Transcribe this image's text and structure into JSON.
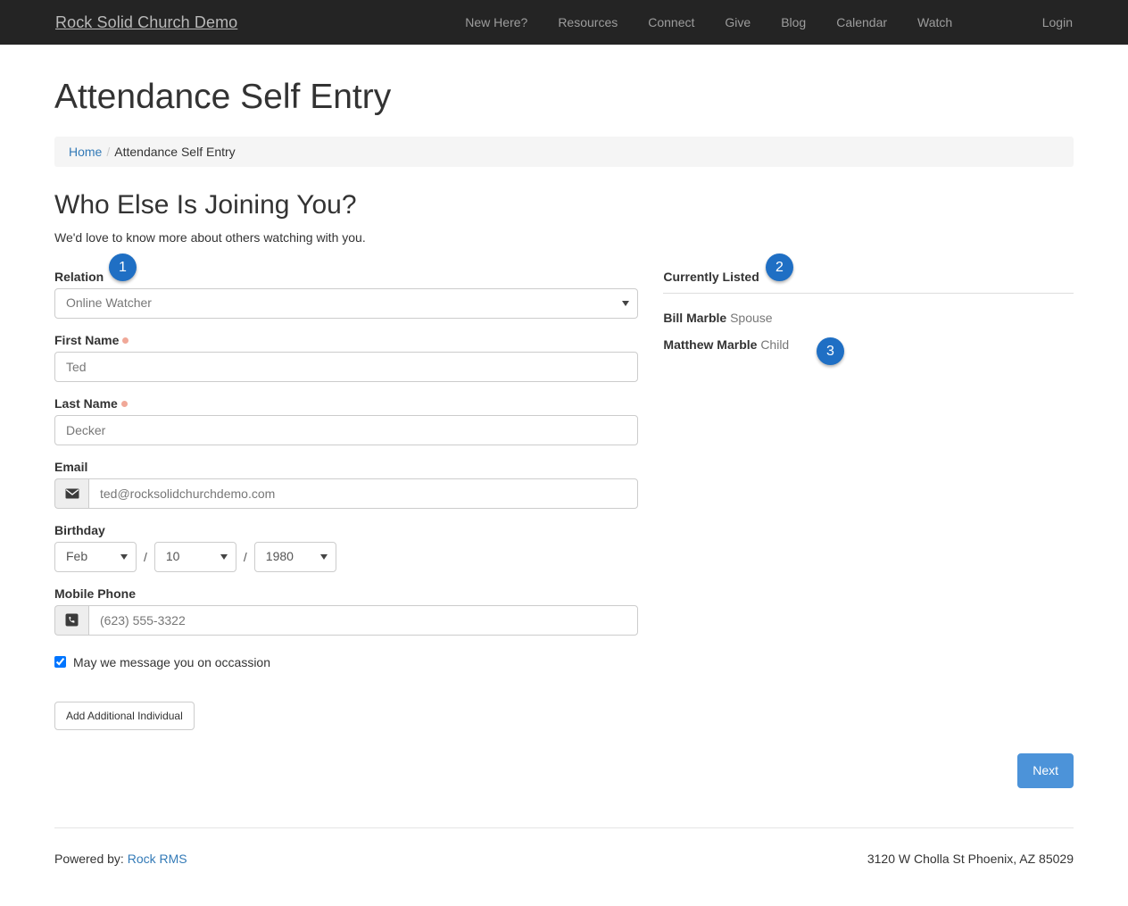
{
  "navbar": {
    "brand": "Rock Solid Church Demo",
    "links": [
      {
        "label": "New Here?"
      },
      {
        "label": "Resources"
      },
      {
        "label": "Connect"
      },
      {
        "label": "Give"
      },
      {
        "label": "Blog"
      },
      {
        "label": "Calendar"
      },
      {
        "label": "Watch"
      }
    ],
    "login_label": "Login",
    "background_color": "#242424",
    "link_color": "#9d9d9d"
  },
  "page": {
    "title": "Attendance Self Entry"
  },
  "breadcrumb": {
    "home_label": "Home",
    "separator": "/",
    "current_label": "Attendance Self Entry"
  },
  "section": {
    "heading": "Who Else Is Joining You?",
    "subtext": "We'd love to know more about others watching with you."
  },
  "form": {
    "relation": {
      "label": "Relation",
      "value": "Online Watcher",
      "options": [
        "Online Watcher"
      ]
    },
    "first_name": {
      "label": "First Name",
      "required": true,
      "placeholder": "Ted",
      "value": ""
    },
    "last_name": {
      "label": "Last Name",
      "required": true,
      "placeholder": "Decker",
      "value": ""
    },
    "email": {
      "label": "Email",
      "placeholder": "ted@rocksolidchurchdemo.com",
      "value": "",
      "icon": "envelope-icon"
    },
    "birthday": {
      "label": "Birthday",
      "separator": "/",
      "month": {
        "value": "Feb",
        "options": [
          "Feb"
        ]
      },
      "day": {
        "value": "10",
        "options": [
          "10"
        ]
      },
      "year": {
        "value": "1980",
        "options": [
          "1980"
        ]
      }
    },
    "mobile_phone": {
      "label": "Mobile Phone",
      "placeholder": "(623) 555-3322",
      "value": "",
      "icon": "phone-square-icon"
    },
    "message_consent": {
      "label": "May we message you on occassion",
      "checked": true
    },
    "add_individual_button": "Add Additional Individual",
    "next_button": "Next"
  },
  "currently_listed": {
    "heading": "Currently Listed",
    "people": [
      {
        "name": "Bill Marble",
        "relation": "Spouse"
      },
      {
        "name": "Matthew Marble",
        "relation": "Child"
      }
    ]
  },
  "footer": {
    "powered_by_label": "Powered by:",
    "powered_by_link": "Rock RMS",
    "address": "3120 W Cholla St Phoenix, AZ 85029"
  },
  "annotations": [
    {
      "number": "1"
    },
    {
      "number": "2"
    },
    {
      "number": "3"
    }
  ],
  "colors": {
    "primary_button": "#4c93d9",
    "annotation_badge": "#1f6fc4",
    "link": "#337ab7",
    "required_dot": "#f0a898"
  }
}
